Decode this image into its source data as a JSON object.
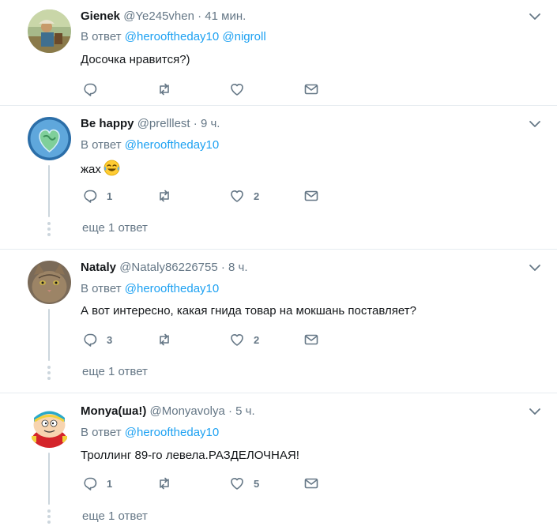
{
  "colors": {
    "accent": "#1da1f2",
    "muted": "#657786",
    "text": "#14171a",
    "divider": "#e6ecf0"
  },
  "tweets": [
    {
      "name": "Gienek",
      "handle": "@Ye245vhen",
      "time": "· 41 мин.",
      "reply_label": "В ответ",
      "mentions": [
        "@herooftheday10",
        "@nigroll"
      ],
      "text": "Досочка нравится?)",
      "emoji": "",
      "replies": "",
      "likes": "",
      "more": ""
    },
    {
      "name": "Be happy",
      "handle": "@prelllest",
      "time": "· 9 ч.",
      "reply_label": "В ответ",
      "mentions": [
        "@herooftheday10"
      ],
      "text": "жах",
      "emoji": "face-with-tears-of-joy",
      "replies": "1",
      "likes": "2",
      "more": "еще 1 ответ"
    },
    {
      "name": "Nataly",
      "handle": "@Nataly86226755",
      "time": "· 8 ч.",
      "reply_label": "В ответ",
      "mentions": [
        "@herooftheday10"
      ],
      "text": "А вот интересно, какая гнида  товар на мокшань поставляет?",
      "emoji": "",
      "replies": "3",
      "likes": "2",
      "more": "еще 1 ответ"
    },
    {
      "name": "Monya(ша!)",
      "handle": "@Monyavolya",
      "time": "· 5 ч.",
      "reply_label": "В ответ",
      "mentions": [
        "@herooftheday10"
      ],
      "text": "Троллинг 89-го левела.РАЗДЕЛОЧНАЯ!",
      "emoji": "",
      "replies": "1",
      "likes": "5",
      "more": "еще 1 ответ"
    }
  ]
}
